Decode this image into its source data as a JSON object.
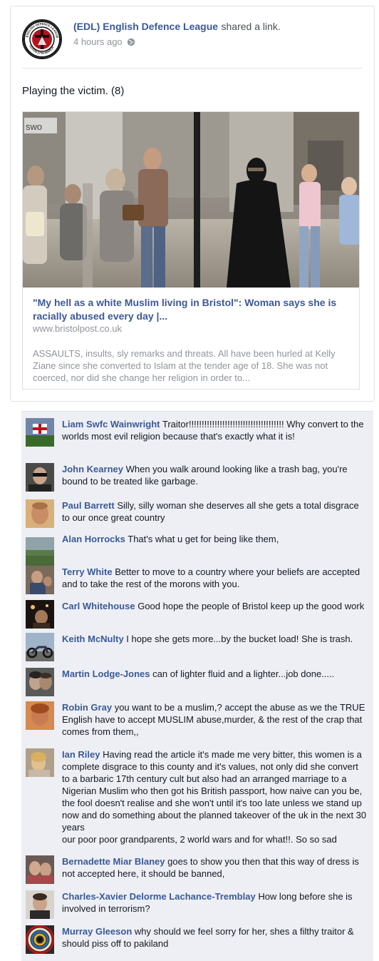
{
  "post": {
    "page_name": "(EDL) English Defence League",
    "action": "shared a link.",
    "timestamp": "4 hours ago",
    "privacy_icon": "globe-icon",
    "message": "Playing the victim. (8)",
    "logo_text_top": "ENGLISH DEFENCE LEAGUE",
    "logo_text_bottom": "LUTON 27TH MARCH",
    "link": {
      "title": "\"My hell as a white Muslim living in Bristol\": Woman says she is racially abused every day |...",
      "domain": "www.bristolpost.co.uk",
      "description": "ASSAULTS, insults, sly remarks and threats. All have been hurled at Kelly Ziane since she converted to Islam at the tender age of 18. She was not coerced, nor did she change her religion in order to...",
      "image_sign_text": "swo"
    }
  },
  "comments": [
    {
      "name": "Liam Swfc Wainwright",
      "text": "Traitor!!!!!!!!!!!!!!!!!!!!!!!!!!!!!!!!!!!!! Why convert to the worlds most evil religion because that's exactly what it is!"
    },
    {
      "name": "John Kearney",
      "text": "When you walk around looking like a trash bag, you're bound to be treated like garbage."
    },
    {
      "name": "Paul Barrett",
      "text": "Silly, silly woman she deserves all she gets a total disgrace to our once great country"
    },
    {
      "name": "Alan Horrocks",
      "text": "That's what u get for being like them,"
    },
    {
      "name": "Terry White",
      "text": "Better to move to a country where your beliefs are accepted and to take the rest of the morons with you."
    },
    {
      "name": "Carl Whitehouse",
      "text": "Good hope the people of Bristol keep up the good work"
    },
    {
      "name": "Keith McNulty",
      "text": "I hope she gets more...by the bucket load! She is trash."
    },
    {
      "name": "Martin Lodge-Jones",
      "text": "can of lighter fluid and a lighter...job done....."
    },
    {
      "name": "Robin Gray",
      "text": "you want to be a muslim,? accept the abuse as we the TRUE English have to accept MUSLIM abuse,murder, & the rest of the crap that comes from them,,"
    },
    {
      "name": "Ian Riley",
      "text": "Having read the article it's made me very bitter, this women is a complete disgrace to this county and it's values, not only did she convert to a barbaric 17th century cult but also had an arranged marriage to a Nigerian Muslim who then got his British passport, how naive can you be, the fool doesn't realise and she won't until it's too late unless we stand up now and do something about the planned takeover of the uk in the next 30 years",
      "text2": "our poor poor grandparents, 2 world wars and for what!!. So so sad"
    },
    {
      "name": "Bernadette Miar Blaney",
      "text": "goes to show you then that this way of dress is not accepted here, it should be banned,"
    },
    {
      "name": "Charles-Xavier Delorme Lachance-Tremblay",
      "text": "How long before she is involved in terrorism?"
    },
    {
      "name": "Murray Gleeson",
      "text": "why should we feel sorry for her, shes a filthy traitor & should piss off to pakiland"
    }
  ],
  "colors": {
    "link_blue": "#3b5998",
    "comment_bg": "#edeff4",
    "meta_gray": "#90949c"
  }
}
